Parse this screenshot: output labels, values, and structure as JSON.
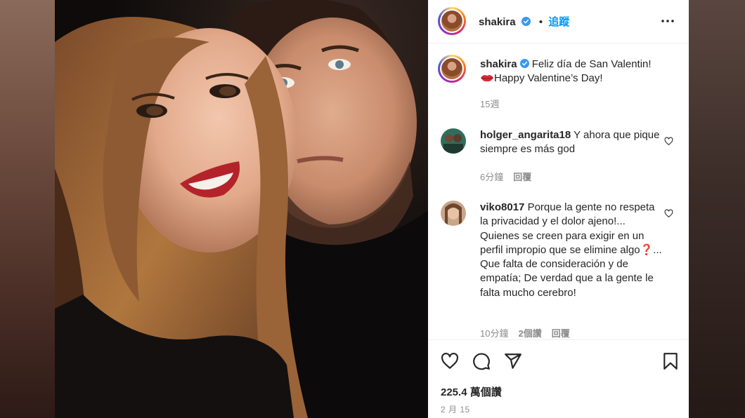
{
  "post": {
    "username": "shakira",
    "follow_label": "追蹤",
    "caption_line1": "Feliz día de San Valentin!",
    "caption_line2": "Happy Valentine’s Day!",
    "caption_time": "15週",
    "likes": "225.4 萬個讚",
    "date": "2 月 15"
  },
  "comments": [
    {
      "username": "holger_angarita18",
      "text": "Y ahora que pique siempre es más god",
      "time": "6分鐘",
      "reply_label": "回覆"
    },
    {
      "username": "viko8017",
      "text": "Porque la gente no respeta la privacidad y el dolor ajeno!... Quienes se creen para exigir en un perfil impropio que se elimine algo❓... Que falta de consideración y de empatía; De verdad que a la gente le falta mucho cerebro!",
      "time": "10分鐘",
      "likes": "2個讚",
      "reply_label": "回覆"
    }
  ],
  "icons": {
    "verified": "verified-badge-icon",
    "more": "more-options-icon",
    "lips": "kiss-lips-emoji",
    "like": "heart-icon",
    "comment": "comment-bubble-icon",
    "share": "paper-plane-icon",
    "save": "bookmark-icon"
  },
  "colors": {
    "accent": "#0095f6",
    "muted": "#8e8e8e",
    "text": "#262626"
  }
}
